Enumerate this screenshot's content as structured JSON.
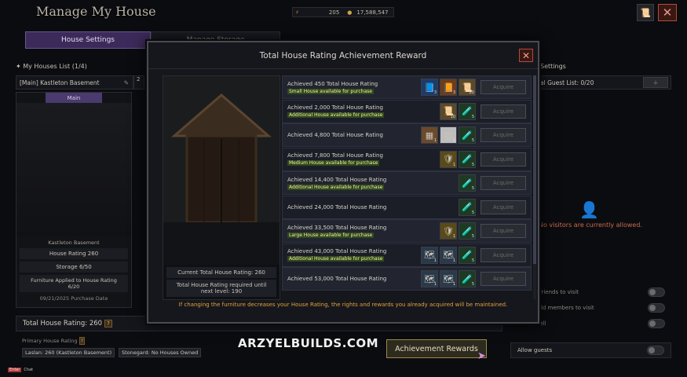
{
  "header": {
    "title": "Manage My House",
    "currency1": "205",
    "currency2": "17,588,547"
  },
  "tabs": {
    "house_settings": "House Settings",
    "manage_storage": "Manage Storage"
  },
  "left": {
    "list_title": "My Houses List (1/4)",
    "house_name": "[Main] Kastleton Basement",
    "main_badge": "Main",
    "house_label": "Kastleton Basement",
    "house_rating": "House Rating 260",
    "storage": "Storage 6/50",
    "furniture": "Furniture Applied to House Rating 6/20",
    "purchase_date": "09/21/2025 Purchase Date",
    "total_rating": "Total House Rating: 260",
    "primary_label": "Primary House Rating",
    "primary1": "Laslan: 260 (Kastleton Basement)",
    "primary2": "Stonegard: No Houses Owned"
  },
  "right": {
    "settings_title": "Settings",
    "guest_list": "al Guest List: 0/20",
    "no_visitors": "No visitors are currently allowed.",
    "opt1": "friends to visit",
    "opt2": "ild members to visit",
    "opt3": "ell",
    "allow_guests": "Allow guests"
  },
  "modal": {
    "title": "Total House Rating Achievement Reward",
    "current": "Current Total House Rating: 260",
    "required": "Total House Rating required until next level: 190",
    "acquire": "Acquire",
    "footer": "If changing the furniture decreases your House Rating, the rights and rewards you already acquired will be maintained.",
    "rows": [
      {
        "title": "Achieved 450 Total House Rating",
        "note": "Small House available for purchase",
        "items": [
          {
            "icon": "blue-tome",
            "count": "3"
          },
          {
            "icon": "orange-tome",
            "count": "3"
          },
          {
            "icon": "scroll",
            "count": "20"
          }
        ]
      },
      {
        "title": "Achieved 2,000 Total House Rating",
        "note": "Additional House available for purchase",
        "items": [
          {
            "icon": "scroll",
            "count": "10"
          },
          {
            "icon": "potion",
            "count": "5"
          }
        ]
      },
      {
        "title": "Achieved 4,800 Total House Rating",
        "note": "",
        "items": [
          {
            "icon": "wood-plank",
            "count": "1"
          },
          {
            "icon": "white-stone",
            "count": "1"
          },
          {
            "icon": "potion",
            "count": "5"
          }
        ]
      },
      {
        "title": "Achieved 7,800 Total House Rating",
        "note": "Medium House available for purchase",
        "items": [
          {
            "icon": "gold-crest",
            "count": "1"
          },
          {
            "icon": "potion",
            "count": "5"
          }
        ]
      },
      {
        "title": "Achieved 14,400 Total House Rating",
        "note": "Additional House available for purchase",
        "items": [
          {
            "icon": "potion",
            "count": "5"
          }
        ]
      },
      {
        "title": "Achieved 24,000 Total House Rating",
        "note": "",
        "items": [
          {
            "icon": "potion",
            "count": "5"
          }
        ]
      },
      {
        "title": "Achieved 33,500 Total House Rating",
        "note": "Large House available for purchase",
        "items": [
          {
            "icon": "gold-crest",
            "count": "1"
          },
          {
            "icon": "potion",
            "count": "5"
          }
        ]
      },
      {
        "title": "Achieved 43,000 Total House Rating",
        "note": "Additional House available for purchase",
        "items": [
          {
            "icon": "blueprint",
            "count": "1"
          },
          {
            "icon": "blueprint",
            "count": "1"
          },
          {
            "icon": "potion",
            "count": "5"
          }
        ]
      },
      {
        "title": "Achieved 53,000 Total House Rating",
        "note": "",
        "items": [
          {
            "icon": "blueprint",
            "count": "1"
          },
          {
            "icon": "blueprint",
            "count": "1"
          },
          {
            "icon": "potion",
            "count": "5"
          }
        ]
      }
    ]
  },
  "watermark": "ARZYELBUILDS.COM",
  "achievement_button": "Achievement Rewards",
  "chat": {
    "key": "Enter",
    "label": "Chat"
  }
}
